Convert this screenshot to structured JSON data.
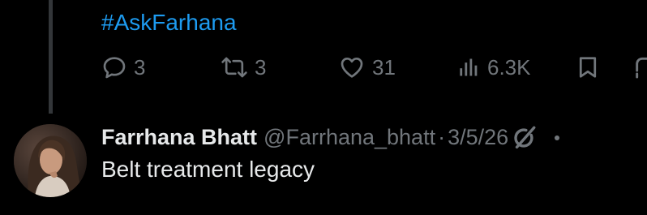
{
  "post": {
    "hashtag": "#AskFarhana",
    "replies": "3",
    "reposts": "3",
    "likes": "31",
    "views": "6.3K"
  },
  "reply": {
    "display_name": "Farrhana Bhatt",
    "handle": "@Farrhana_bhatt",
    "separator": "·",
    "date": "3/5/26",
    "text": "Belt treatment legacy"
  },
  "colors": {
    "background": "#000000",
    "text": "#e7e9ea",
    "muted": "#71767b",
    "link": "#1d9bf0",
    "thread_line": "#333639"
  },
  "icons": [
    "reply-icon",
    "repost-icon",
    "like-icon",
    "views-icon",
    "bookmark-icon",
    "share-icon",
    "grok-icon",
    "more-icon"
  ]
}
